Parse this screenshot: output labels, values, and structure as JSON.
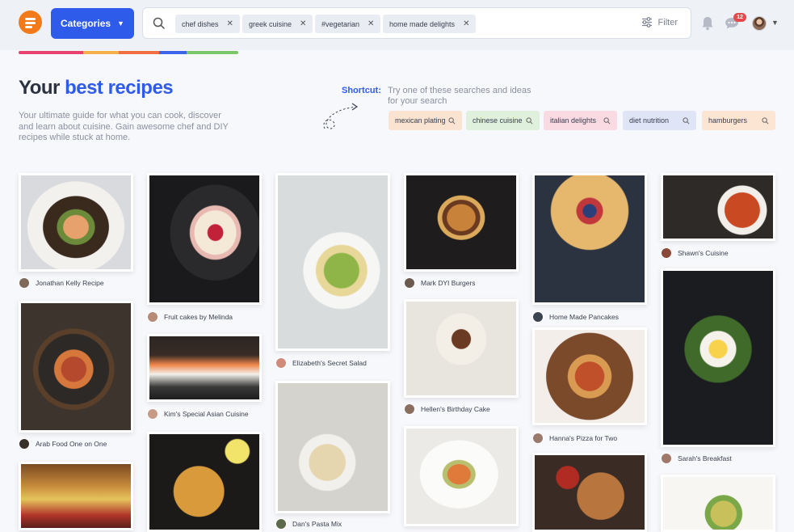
{
  "header": {
    "categories_label": "Categories",
    "search_chips": [
      "chef dishes",
      "greek cuisine",
      "#vegetarian",
      "home made delights"
    ],
    "filter_label": "Filter",
    "message_count": "12",
    "accent_color": "#2f5bea",
    "brand_color": "#f27a1a",
    "icons": [
      "menu-logo-icon",
      "chevron-down-icon",
      "search-icon",
      "close-icon",
      "sliders-icon",
      "bell-icon",
      "chat-icon",
      "chevron-down-icon"
    ]
  },
  "hero": {
    "title_prefix": "Your",
    "title_accent": "best recipes",
    "description": "Your ultimate guide for what you can cook, discover and learn about cuisine. Gain awesome chef and DIY recipes while stuck at home.",
    "shortcut_label": "Shortcut:",
    "shortcut_hint": "Try one of these searches and ideas for your search",
    "quick_searches": [
      {
        "label": "mexican plating",
        "color": "#fbe3d2"
      },
      {
        "label": "chinese cuisine",
        "color": "#dff0dc"
      },
      {
        "label": "italian delights",
        "color": "#fadbe3"
      },
      {
        "label": "diet nutrition",
        "color": "#dfe4f7"
      },
      {
        "label": "hamburgers",
        "color": "#fde5d4"
      }
    ]
  },
  "recipes": [
    {
      "author": "Jonathan Kelly Recipe"
    },
    {
      "author": "Arab Food One on One"
    },
    {
      "author": ""
    },
    {
      "author": "Fruit cakes by Melinda"
    },
    {
      "author": "Kim's Special Asian Cuisine"
    },
    {
      "author": ""
    },
    {
      "author": "Elizabeth's Secret Salad"
    },
    {
      "author": "Dan's Pasta Mix"
    },
    {
      "author": "Mark DYI Burgers"
    },
    {
      "author": "Hellen's Birthday Cake"
    },
    {
      "author": ""
    },
    {
      "author": "Home Made Pancakes"
    },
    {
      "author": "Hanna's Pizza for Two"
    },
    {
      "author": ""
    },
    {
      "author": "Shawn's Cuisine"
    },
    {
      "author": "Sarah's Breakfast"
    },
    {
      "author": ""
    }
  ]
}
